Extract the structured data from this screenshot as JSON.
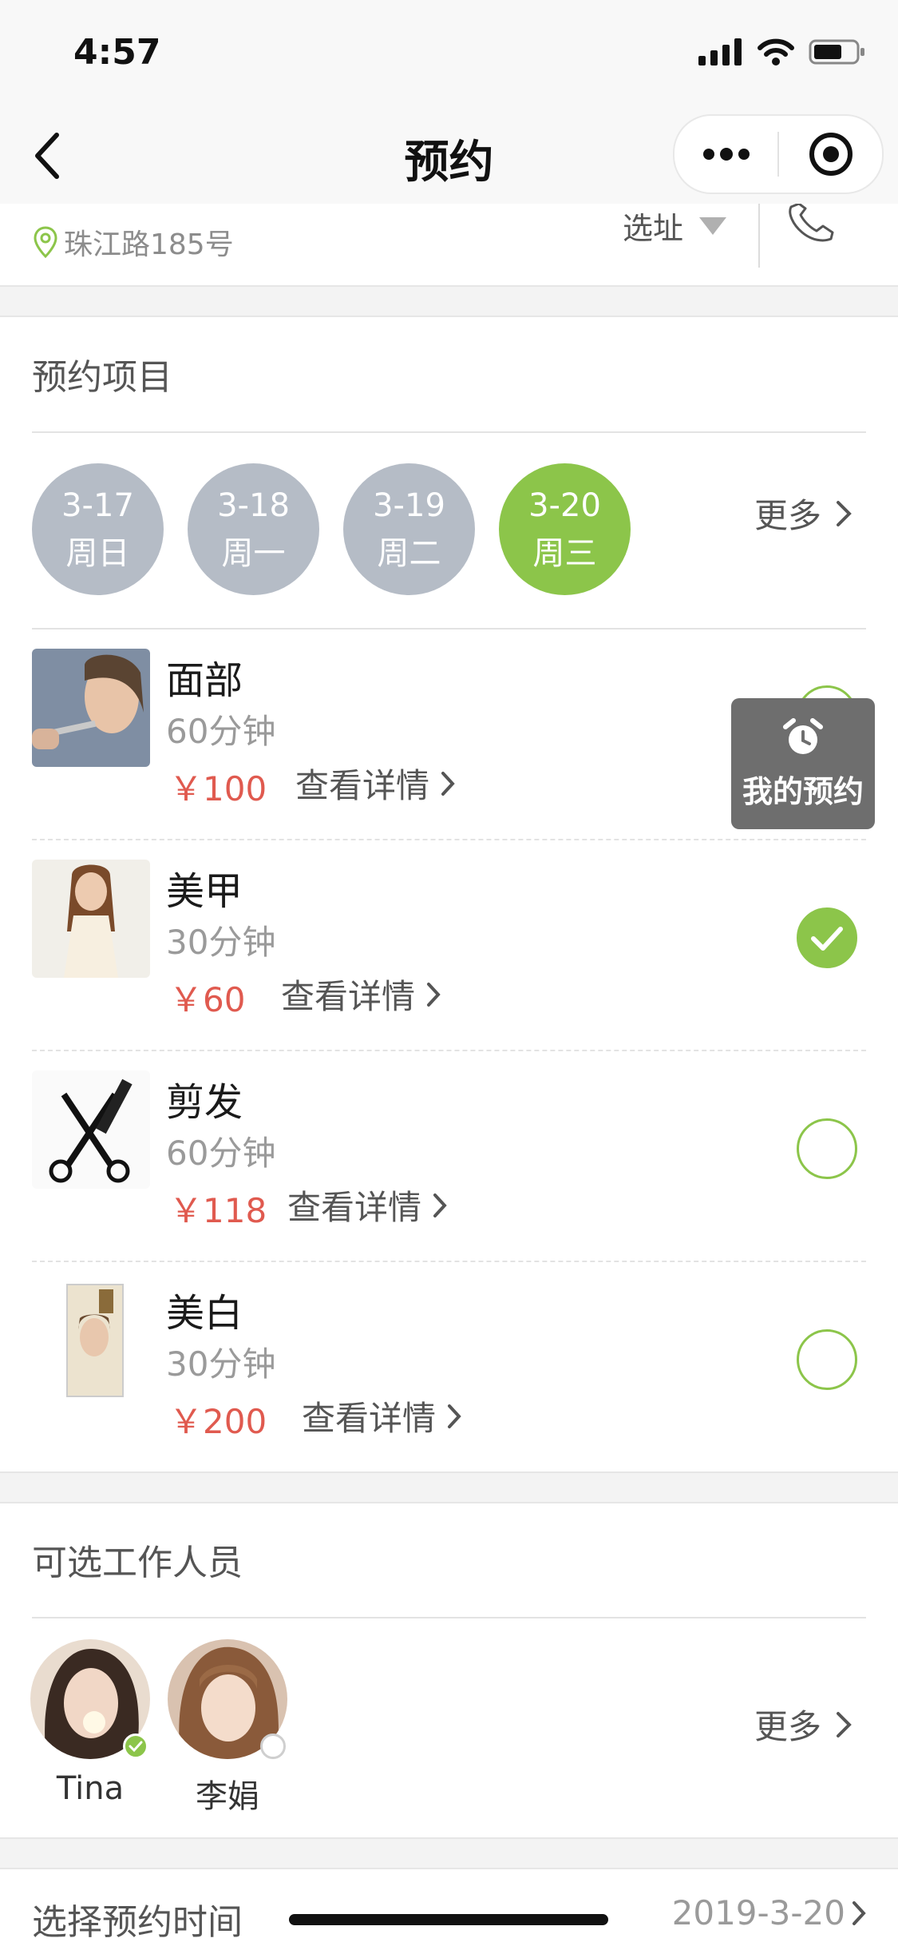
{
  "status": {
    "time": "4:57"
  },
  "nav": {
    "title": "预约"
  },
  "store": {
    "address": "珠江路185号",
    "select_label": "选址"
  },
  "section_projects": {
    "title": "预约项目"
  },
  "dates": [
    {
      "date": "3-17",
      "weekday": "周日",
      "active": false
    },
    {
      "date": "3-18",
      "weekday": "周一",
      "active": false
    },
    {
      "date": "3-19",
      "weekday": "周二",
      "active": false
    },
    {
      "date": "3-20",
      "weekday": "周三",
      "active": true
    }
  ],
  "dates_more": "更多",
  "services": [
    {
      "name": "面部",
      "duration": "60分钟",
      "price": "￥100",
      "detail": "查看详情",
      "selected": false
    },
    {
      "name": "美甲",
      "duration": "30分钟",
      "price": "￥60",
      "detail": "查看详情",
      "selected": true
    },
    {
      "name": "剪发",
      "duration": "60分钟",
      "price": "￥118",
      "detail": "查看详情",
      "selected": false
    },
    {
      "name": "美白",
      "duration": "30分钟",
      "price": "￥200",
      "detail": "查看详情",
      "selected": false
    }
  ],
  "my_appointment": {
    "label": "我的预约"
  },
  "section_staff": {
    "title": "可选工作人员"
  },
  "staff": [
    {
      "name": "Tina",
      "selected": true
    },
    {
      "name": "李娟",
      "selected": false
    }
  ],
  "staff_more": "更多",
  "time": {
    "label": "选择预约时间",
    "value": "2019-3-20"
  },
  "colors": {
    "accent": "#8cc54a",
    "price": "#e05a4f",
    "date_inactive": "#b5bcc6"
  }
}
